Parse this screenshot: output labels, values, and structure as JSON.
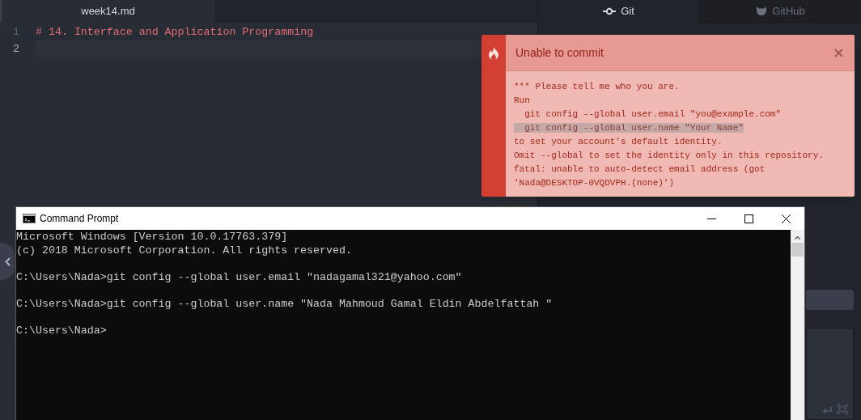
{
  "editor": {
    "tab": {
      "label": "week14.md",
      "selected": true
    },
    "lines": [
      {
        "number": "1",
        "text": "# 14. Interface and Application Programming",
        "current": false
      },
      {
        "number": "2",
        "current": true
      }
    ]
  },
  "side_panel": {
    "tabs": [
      {
        "label": "Git",
        "kind": "git",
        "selected": true
      },
      {
        "label": "GitHub",
        "kind": "github",
        "selected": false
      }
    ]
  },
  "notification": {
    "title": "Unable to commit",
    "lines": [
      {
        "text": "*** Please tell me who you are.",
        "highlighted": false
      },
      {
        "text": "Run",
        "highlighted": false
      },
      {
        "text": "  git config --global user.email \"you@example.com\"",
        "highlighted": false
      },
      {
        "text": "  git config --global user.name \"Your Name\"",
        "highlighted": true
      },
      {
        "text": "to set your account's default identity.",
        "highlighted": false
      },
      {
        "text": "Omit --global to set the identity only in this repository.",
        "highlighted": false
      },
      {
        "text": "fatal: unable to auto-detect email address (got",
        "highlighted": false
      },
      {
        "text": "'Nada@DESKTOP-0VQDVPH.(none)')",
        "highlighted": false
      }
    ]
  },
  "command_prompt": {
    "title": "Command Prompt",
    "blocks": [
      [
        "Microsoft Windows [Version 10.0.17763.379]",
        "(c) 2018 Microsoft Corporation. All rights reserved."
      ],
      [
        "C:\\Users\\Nada>git config --global user.email \"nadagamal321@yahoo.com\""
      ],
      [
        "C:\\Users\\Nada>git config --global user.name \"Nada Mahmoud Gamal Eldin Abdelfattah \""
      ],
      [
        "C:\\Users\\Nada>"
      ]
    ]
  }
}
